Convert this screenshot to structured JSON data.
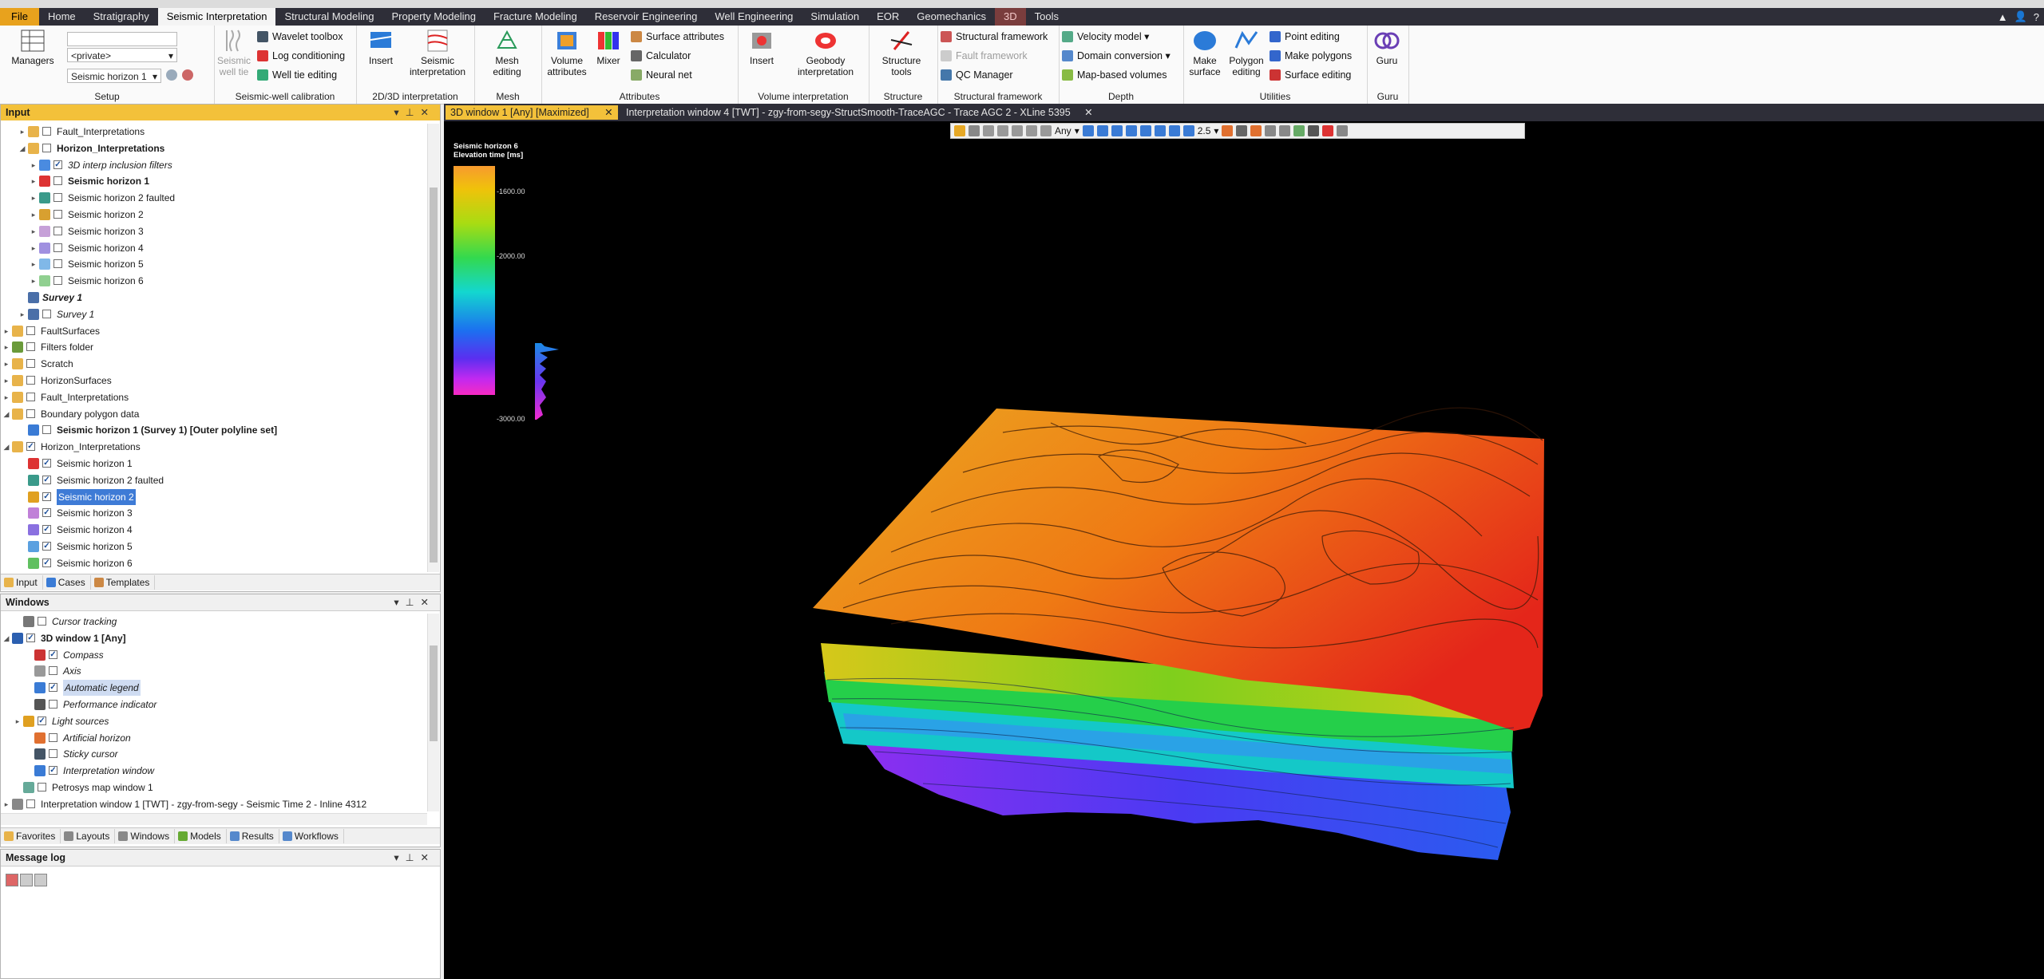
{
  "menubar": {
    "items": [
      "File",
      "Home",
      "Stratigraphy",
      "Seismic Interpretation",
      "Structural Modeling",
      "Property Modeling",
      "Fracture Modeling",
      "Reservoir Engineering",
      "Well Engineering",
      "Simulation",
      "EOR",
      "Geomechanics",
      "3D",
      "Tools"
    ],
    "active": "Seismic Interpretation"
  },
  "ribbon": {
    "setup": {
      "managers": "Managers",
      "private_combo": "<private>",
      "horizon_combo": "Seismic horizon 1",
      "label": "Setup"
    },
    "calibration": {
      "seismic_well_tie": "Seismic well tie",
      "wavelet_toolbox": "Wavelet toolbox",
      "log_conditioning": "Log conditioning",
      "well_tie_editing": "Well tie editing",
      "label": "Seismic-well calibration"
    },
    "interp2d3d": {
      "insert": "Insert",
      "seismic_interpretation": "Seismic interpretation",
      "label": "2D/3D interpretation"
    },
    "mesh": {
      "mesh_editing": "Mesh editing",
      "label": "Mesh"
    },
    "attributes": {
      "volume_attributes": "Volume attributes",
      "mixer": "Mixer",
      "surface_attributes": "Surface attributes",
      "calculator": "Calculator",
      "neural_net": "Neural net",
      "label": "Attributes"
    },
    "volume_interp": {
      "insert": "Insert",
      "geobody_interpretation": "Geobody interpretation",
      "label": "Volume interpretation"
    },
    "structure": {
      "structure_tools": "Structure tools",
      "label": "Structure"
    },
    "structural_framework": {
      "structural_framework": "Structural framework",
      "fault_framework": "Fault framework",
      "qc_manager": "QC Manager",
      "label": "Structural framework"
    },
    "depth": {
      "velocity_model": "Velocity model",
      "domain_conversion": "Domain conversion",
      "map_based_volumes": "Map-based volumes",
      "label": "Depth"
    },
    "utilities": {
      "make_surface": "Make surface",
      "polygon_editing": "Polygon editing",
      "point_editing": "Point editing",
      "make_polygons": "Make polygons",
      "surface_editing": "Surface editing",
      "label": "Utilities"
    },
    "guru": {
      "guru": "Guru",
      "label": "Guru"
    }
  },
  "input_panel": {
    "title": "Input",
    "rows": [
      {
        "label": "Fault_Interpretations",
        "style": ""
      },
      {
        "label": "Horizon_Interpretations",
        "style": "b"
      },
      {
        "label": "3D interp inclusion filters",
        "style": "i"
      },
      {
        "label": "Seismic horizon 1",
        "style": "b"
      },
      {
        "label": "Seismic horizon 2 faulted",
        "style": ""
      },
      {
        "label": "Seismic horizon 2",
        "style": ""
      },
      {
        "label": "Seismic horizon 3",
        "style": ""
      },
      {
        "label": "Seismic horizon 4",
        "style": ""
      },
      {
        "label": "Seismic horizon 5",
        "style": ""
      },
      {
        "label": "Seismic horizon 6",
        "style": ""
      },
      {
        "label": "Survey 1",
        "style": "bi"
      },
      {
        "label": "Survey 1",
        "style": "i"
      },
      {
        "label": "FaultSurfaces",
        "style": ""
      },
      {
        "label": "Filters folder",
        "style": ""
      },
      {
        "label": "Scratch",
        "style": ""
      },
      {
        "label": "HorizonSurfaces",
        "style": ""
      },
      {
        "label": "Fault_Interpretations",
        "style": ""
      },
      {
        "label": "Boundary polygon data",
        "style": ""
      },
      {
        "label": "Seismic horizon 1 (Survey 1) [Outer polyline set]",
        "style": "b"
      },
      {
        "label": "Horizon_Interpretations",
        "style": ""
      },
      {
        "label": "Seismic horizon 1",
        "style": ""
      },
      {
        "label": "Seismic horizon 2 faulted",
        "style": ""
      },
      {
        "label": "Seismic horizon 2",
        "style": "sel"
      },
      {
        "label": "Seismic horizon 3",
        "style": ""
      },
      {
        "label": "Seismic horizon 4",
        "style": ""
      },
      {
        "label": "Seismic horizon 5",
        "style": ""
      },
      {
        "label": "Seismic horizon 6",
        "style": ""
      }
    ],
    "tabs": [
      "Input",
      "Cases",
      "Templates"
    ]
  },
  "windows_panel": {
    "title": "Windows",
    "rows": [
      {
        "label": "Cursor tracking",
        "style": "i"
      },
      {
        "label": "3D window 1 [Any]",
        "style": "b"
      },
      {
        "label": "Compass",
        "style": "i"
      },
      {
        "label": "Axis",
        "style": "i"
      },
      {
        "label": "Automatic legend",
        "style": "isoft"
      },
      {
        "label": "Performance indicator",
        "style": "i"
      },
      {
        "label": "Light sources",
        "style": "i"
      },
      {
        "label": "Artificial horizon",
        "style": "i"
      },
      {
        "label": "Sticky cursor",
        "style": "i"
      },
      {
        "label": "Interpretation window",
        "style": "i"
      },
      {
        "label": "Petrosys map window 1",
        "style": ""
      },
      {
        "label": "Interpretation window 1 [TWT] - zgy-from-segy - Seismic Time 2 - Inline 4312",
        "style": ""
      }
    ],
    "tabs": [
      "Favorites",
      "Layouts",
      "Windows",
      "Models",
      "Results",
      "Workflows"
    ]
  },
  "message_log": {
    "title": "Message log"
  },
  "viewport": {
    "tabs": [
      "3D window 1 [Any] [Maximized]",
      "Interpretation window 4 [TWT] - zgy-from-segy-StructSmooth-TraceAGC - Trace AGC 2 - XLine 5395"
    ],
    "toolbar": {
      "domain": "Any",
      "zoom": "2.5"
    },
    "legend": {
      "title": "Seismic horizon 6\nElevation time [ms]",
      "ticks": [
        "-1600.00",
        "-2000.00",
        "-3000.00"
      ]
    }
  },
  "colors": {
    "accent": "#e8a21d",
    "menubar": "#2e2e38",
    "selection": "#3e7bd6",
    "active_view_tab": "#f3c13a"
  }
}
